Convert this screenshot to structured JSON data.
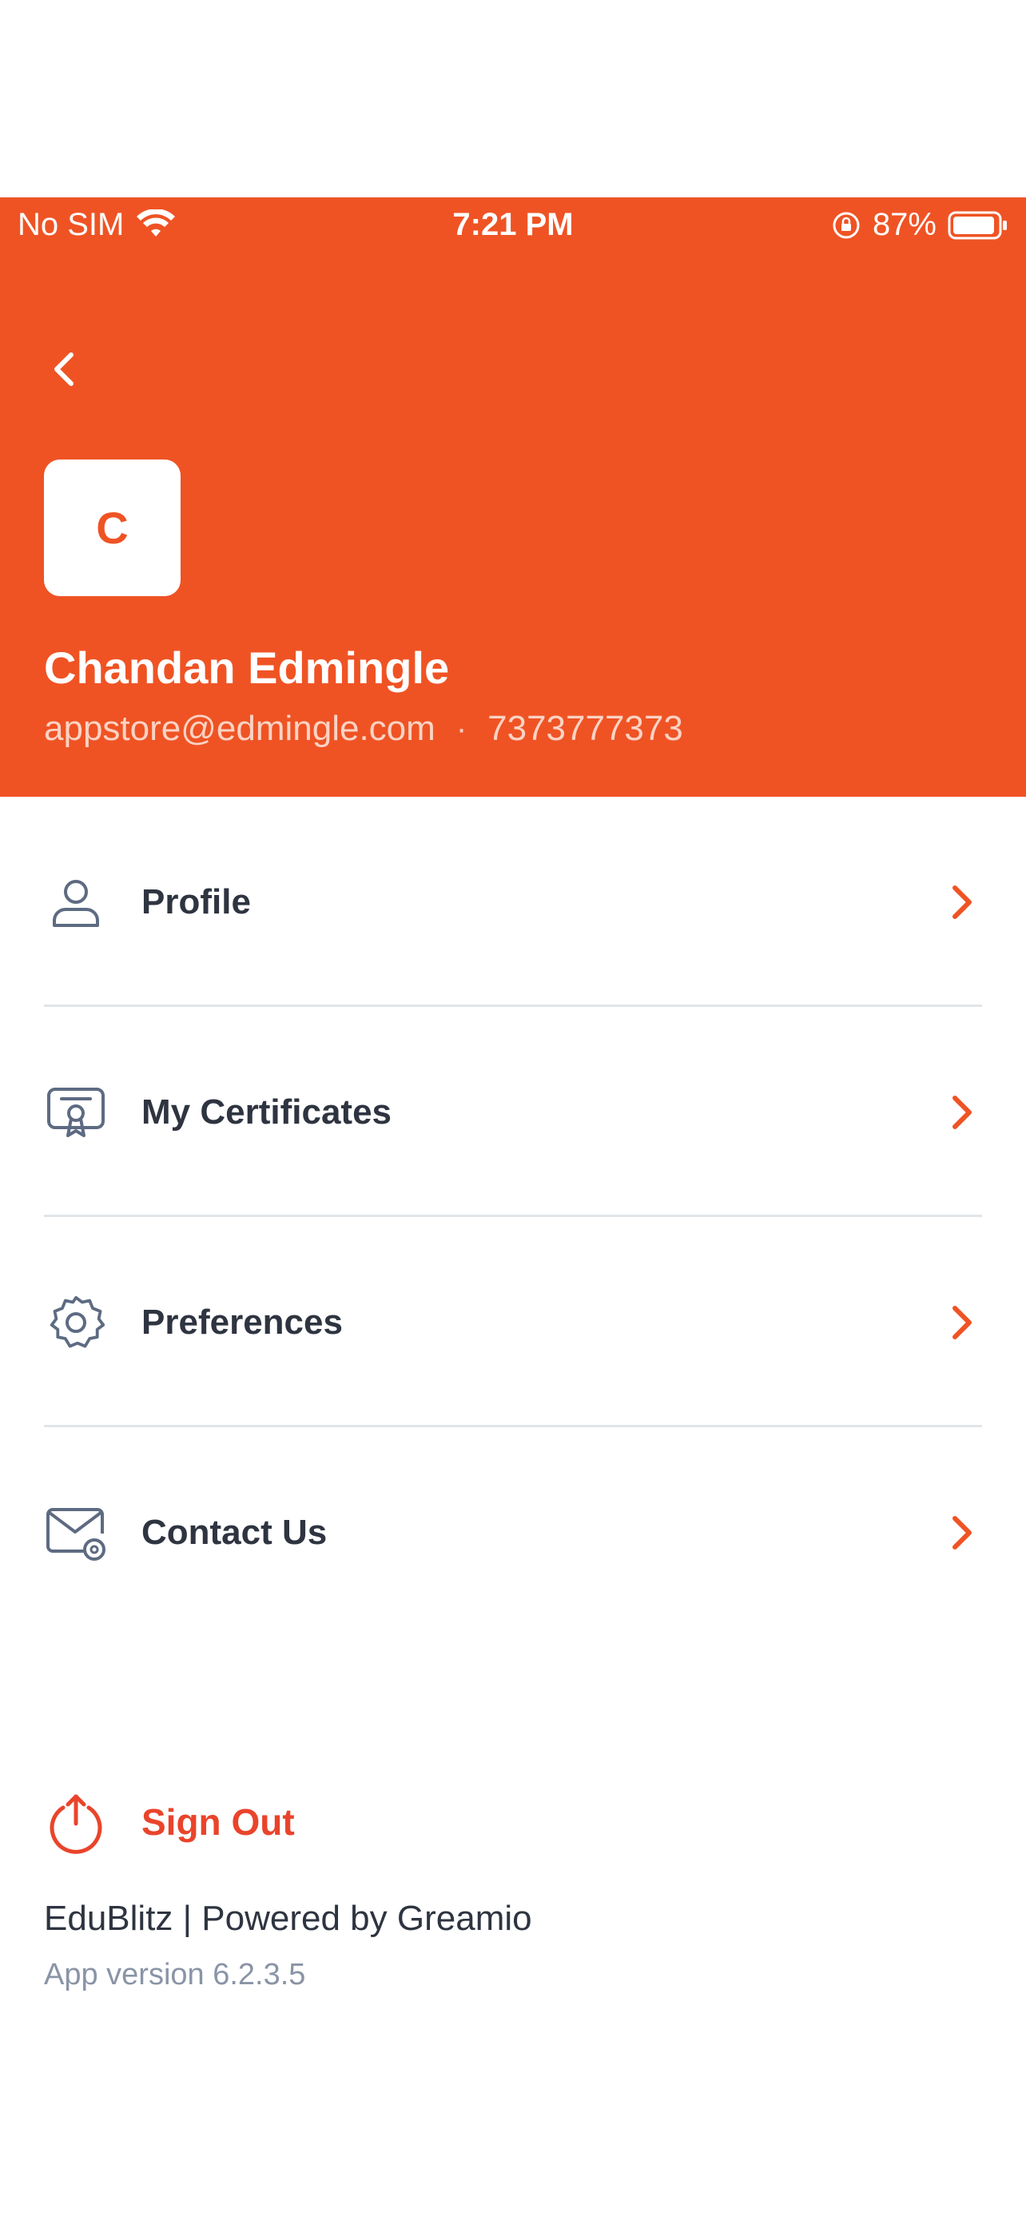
{
  "status_bar": {
    "carrier": "No SIM",
    "time": "7:21 PM",
    "battery": "87%"
  },
  "header": {
    "avatar_initial": "C",
    "name": "Chandan Edmingle",
    "email": "appstore@edmingle.com",
    "separator": "·",
    "phone": "7373777373"
  },
  "menu": {
    "items": [
      {
        "label": "Profile",
        "icon": "user-icon"
      },
      {
        "label": "My Certificates",
        "icon": "certificate-icon"
      },
      {
        "label": "Preferences",
        "icon": "gear-icon"
      },
      {
        "label": "Contact Us",
        "icon": "mail-icon"
      }
    ]
  },
  "signout": {
    "label": "Sign Out",
    "icon": "power-icon"
  },
  "footer": {
    "brand": "EduBlitz | Powered by Greamio",
    "version": "App version 6.2.3.5"
  },
  "colors": {
    "accent": "#EF5324",
    "signout": "#E9442B",
    "icon": "#5D6B82"
  }
}
